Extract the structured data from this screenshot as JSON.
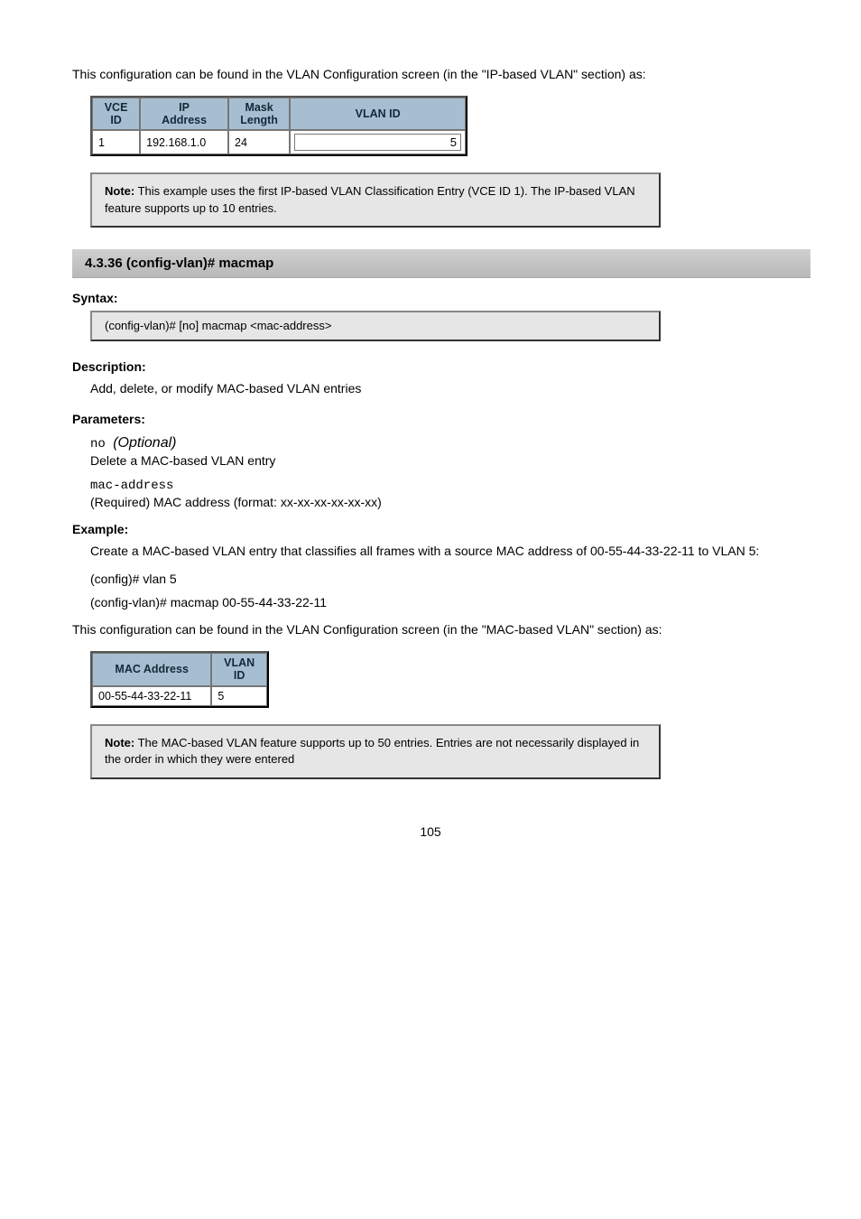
{
  "intro_text": "This configuration can be found in the VLAN Configuration screen (in the \"IP-based VLAN\" section) as:",
  "ip_table": {
    "headers": {
      "vce": "VCE\nID",
      "ip": "IP\nAddress",
      "mask": "Mask\nLength",
      "vlan": "VLAN ID"
    },
    "row": {
      "vce": "1",
      "ip": "192.168.1.0",
      "mask": "24",
      "vlan": "5"
    }
  },
  "note1": {
    "bold": "Note:",
    "rest": " This example uses the first IP-based VLAN Classification Entry (VCE ID 1). The IP-based VLAN feature supports up to 10 entries."
  },
  "section_heading": "4.3.36 (config-vlan)# macmap",
  "syntax_label": "Syntax:",
  "syntax_box": "(config-vlan)# [no] macmap <mac-address>",
  "description_label": "Description:",
  "description_text": "Add, delete, or modify MAC-based VLAN entries",
  "parameters_label": "Parameters:",
  "params": {
    "no": {
      "name": "no ",
      "opt": "(Optional)",
      "desc": "Delete a MAC-based VLAN entry"
    },
    "mac": {
      "name": "mac-address",
      "desc": "(Required) MAC address (format: xx-xx-xx-xx-xx-xx)"
    }
  },
  "example_label": "Example:",
  "example_text": "Create a MAC-based VLAN entry that classifies all frames with a source MAC address of 00-55-44-33-22-11 to VLAN 5:",
  "example_cmd1": "(config)# vlan 5",
  "example_cmd2": "(config-vlan)# macmap 00-55-44-33-22-11",
  "mac_note_text": "This configuration can be found in the VLAN Configuration screen (in the \"MAC-based VLAN\" section) as:",
  "mac_table": {
    "headers": {
      "mac": "MAC Address",
      "vlan": "VLAN\nID"
    },
    "row": {
      "mac": "00-55-44-33-22-11",
      "vlan": "5"
    }
  },
  "note2": {
    "bold": "Note:",
    "rest": " The MAC-based VLAN feature supports up to 50 entries. Entries are not necessarily displayed in the order in which they were entered"
  },
  "footer": "105"
}
